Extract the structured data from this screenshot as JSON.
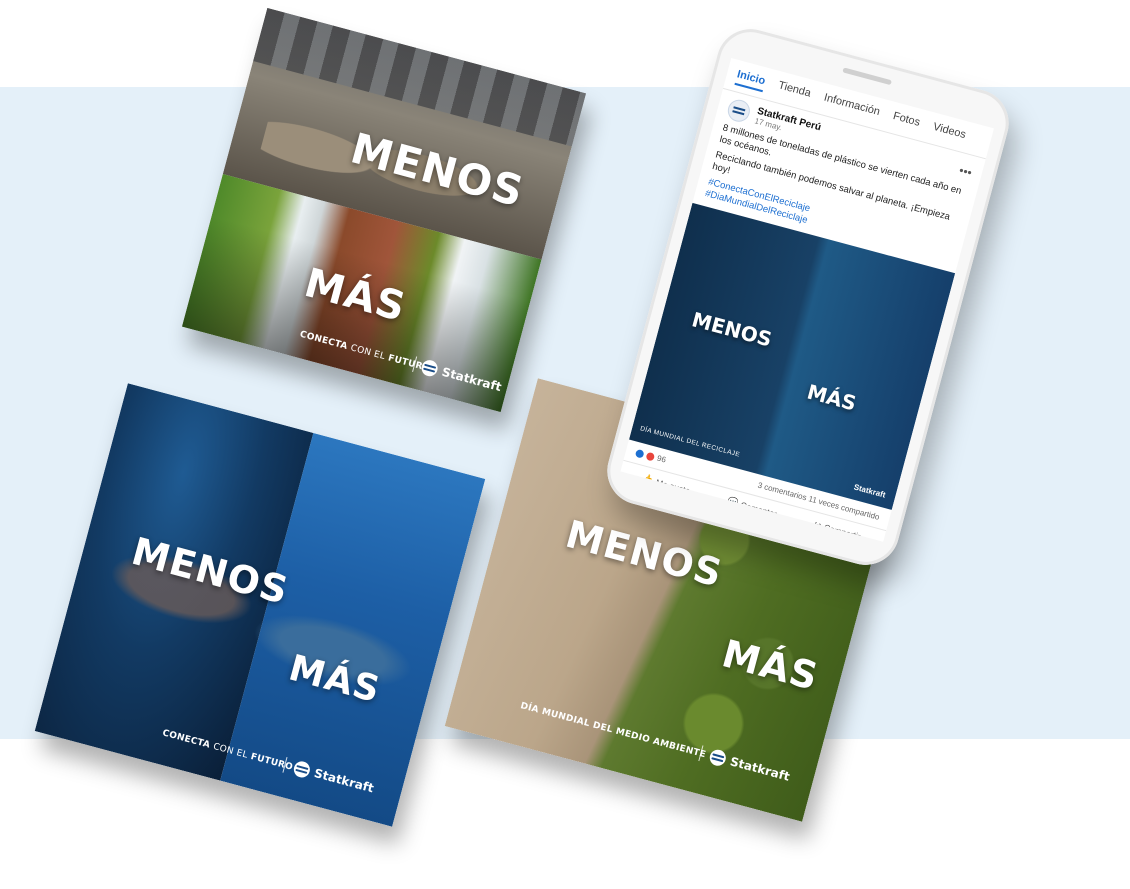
{
  "cards": {
    "menos": "MENOS",
    "mas": "MÁS",
    "conecta_bold": "CONECTA",
    "conecta_thin": "CON EL",
    "futuro": "FUTURO",
    "brand": "Statkraft",
    "dia_medio": "DÍA MUNDIAL DEL MEDIO AMBIENTE"
  },
  "phone": {
    "tabs": [
      "Inicio",
      "Tienda",
      "Información",
      "Fotos",
      "Videos"
    ],
    "page_name": "Statkraft Perú",
    "date": "17 may.",
    "more": "•••",
    "text1": "8 millones de toneladas de plástico se vierten cada año en los océanos.",
    "text2": "Reciclando también podemos salvar al planeta. ¡Empieza hoy!",
    "hashtag1": "#ConectaConElReciclaje",
    "hashtag2": "#DiaMundialDelReciclaje",
    "image_menos": "MENOS",
    "image_mas": "MÁS",
    "image_caption": "DÍA MUNDIAL DEL RECICLAJE",
    "image_brand": "Statkraft",
    "reactions": "96",
    "comments_shares": "3 comentarios 11 veces compartido",
    "like": "Me gusta",
    "comment": "Comentar",
    "share": "Compartir"
  },
  "colors": {
    "band": "#e4f0f9",
    "fb_blue": "#1d6fd1"
  }
}
